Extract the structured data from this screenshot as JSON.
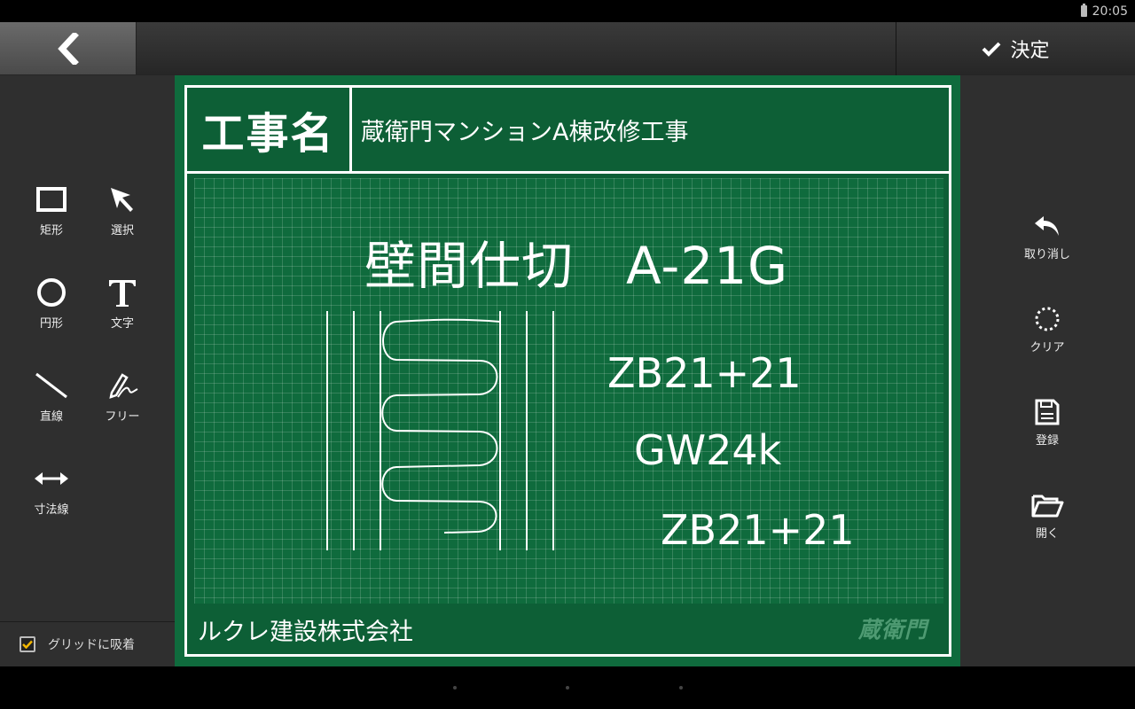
{
  "status": {
    "time": "20:05"
  },
  "header": {
    "confirm_label": "決定"
  },
  "left_tools": [
    {
      "label": "矩形",
      "icon": "rectangle-icon"
    },
    {
      "label": "選択",
      "icon": "cursor-arrow-icon"
    },
    {
      "label": "円形",
      "icon": "circle-icon"
    },
    {
      "label": "文字",
      "icon": "text-t-icon"
    },
    {
      "label": "直線",
      "icon": "line-icon"
    },
    {
      "label": "フリー",
      "icon": "pen-freehand-icon"
    },
    {
      "label": "寸法線",
      "icon": "dimension-arrow-icon"
    }
  ],
  "snap": {
    "label": "グリッドに吸着",
    "checked": true
  },
  "right_tools": [
    {
      "label": "取り消し",
      "icon": "undo-icon"
    },
    {
      "label": "クリア",
      "icon": "clear-dotted-circle-icon"
    },
    {
      "label": "登録",
      "icon": "save-icon"
    },
    {
      "label": "開く",
      "icon": "folder-open-icon"
    }
  ],
  "board": {
    "title_label": "工事名",
    "title_value": "蔵衛門マンションA棟改修工事",
    "heading": "壁間仕切　A-21G",
    "layers": [
      "ZB21+21",
      "GW24k",
      "ZB21+21"
    ],
    "company": "ルクレ建設株式会社",
    "logo_text": "蔵衛門"
  },
  "colors": {
    "board_green": "#0d5f36",
    "accent_check": "#f2b600"
  }
}
